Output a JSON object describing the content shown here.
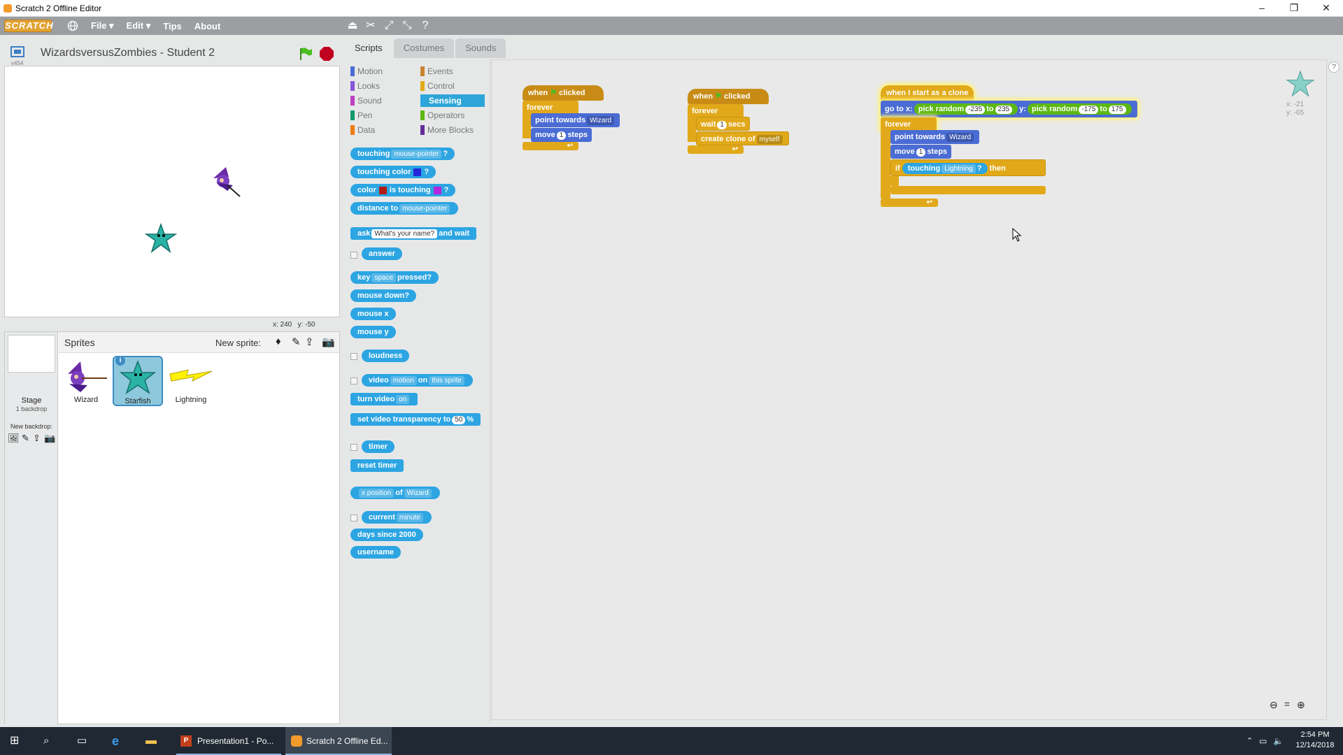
{
  "window": {
    "title": "Scratch 2 Offline Editor",
    "minimize": "–",
    "restore": "❐",
    "close": "✕"
  },
  "menubar": {
    "logo": "SCRATCH",
    "items": [
      "File ▾",
      "Edit ▾",
      "Tips",
      "About"
    ]
  },
  "stage": {
    "project_title": "WizardsversusZombies - Student 2",
    "version": "v454",
    "mouse_x": "x: 240",
    "mouse_y": "y: -50"
  },
  "tabs": [
    "Scripts",
    "Costumes",
    "Sounds"
  ],
  "categories": {
    "left": [
      "Motion",
      "Looks",
      "Sound",
      "Pen",
      "Data"
    ],
    "right": [
      "Events",
      "Control",
      "Sensing",
      "Operators",
      "More Blocks"
    ],
    "colors": {
      "Motion": "#4a6cd4",
      "Looks": "#8a55d7",
      "Sound": "#bb42c3",
      "Pen": "#0e9a6c",
      "Data": "#ee7d16",
      "Events": "#c88330",
      "Control": "#e1a91a",
      "Sensing": "#2ca5e2",
      "Operators": "#5cb712",
      "More Blocks": "#632d99"
    }
  },
  "palette": {
    "touching": "touching",
    "touching_target": "mouse-pointer",
    "touching_q": "?",
    "touching_color": "touching color",
    "touching_color_q": "?",
    "color_label": "color",
    "is_touching": "is touching",
    "color_q": "?",
    "distance_to": "distance to",
    "distance_target": "mouse-pointer",
    "ask": "ask",
    "ask_default": "What's your name?",
    "and_wait": "and wait",
    "answer": "answer",
    "key": "key",
    "key_value": "space",
    "pressed": "pressed?",
    "mouse_down": "mouse down?",
    "mouse_x": "mouse x",
    "mouse_y": "mouse y",
    "loudness": "loudness",
    "video": "video",
    "video_attr": "motion",
    "on": "on",
    "video_target": "this sprite",
    "turn_video": "turn video",
    "turn_video_value": "on",
    "set_video_transparency": "set video transparency to",
    "transparency_value": "50",
    "percent": "%",
    "timer": "timer",
    "reset_timer": "reset timer",
    "x_position": "x position",
    "of": "of",
    "of_target": "Wizard",
    "current": "current",
    "current_unit": "minute",
    "days_since": "days since 2000",
    "username": "username"
  },
  "scripts": {
    "s1": {
      "when": "when",
      "clicked": "clicked",
      "forever": "forever",
      "point_towards": "point towards",
      "target": "Wizard",
      "move": "move",
      "steps_val": "1",
      "steps": "steps"
    },
    "s2": {
      "when": "when",
      "clicked": "clicked",
      "forever": "forever",
      "wait": "wait",
      "wait_val": "1",
      "secs": "secs",
      "create_clone": "create clone of",
      "clone_target": "myself"
    },
    "s3": {
      "hat": "when I start as a clone",
      "go_to_x": "go to x:",
      "pick_random": "pick random",
      "x_from": "-235",
      "to": "to",
      "x_to": "235",
      "y_label": "y:",
      "y_from": "-175",
      "y_to": "175",
      "forever": "forever",
      "point_towards": "point towards",
      "target": "Wizard",
      "move": "move",
      "steps_val": "1",
      "steps": "steps",
      "if": "if",
      "touching": "touching",
      "touching_target": "Lightning",
      "q": "?",
      "then": "then"
    }
  },
  "sprite_info": {
    "x": "x: -21",
    "y": "y: -65"
  },
  "sprites_panel": {
    "header": "Sprites",
    "new_sprite": "New sprite:",
    "stage_label": "Stage",
    "stage_backdrops": "1 backdrop",
    "new_backdrop": "New backdrop:",
    "sprites": [
      {
        "name": "Wizard",
        "selected": false
      },
      {
        "name": "Starfish",
        "selected": true
      },
      {
        "name": "Lightning",
        "selected": false
      }
    ]
  },
  "taskbar": {
    "apps": [
      {
        "label": "Presentation1 - Po...",
        "active": false
      },
      {
        "label": "Scratch 2 Offline Ed...",
        "active": true
      }
    ],
    "time": "2:54 PM",
    "date": "12/14/2018"
  }
}
